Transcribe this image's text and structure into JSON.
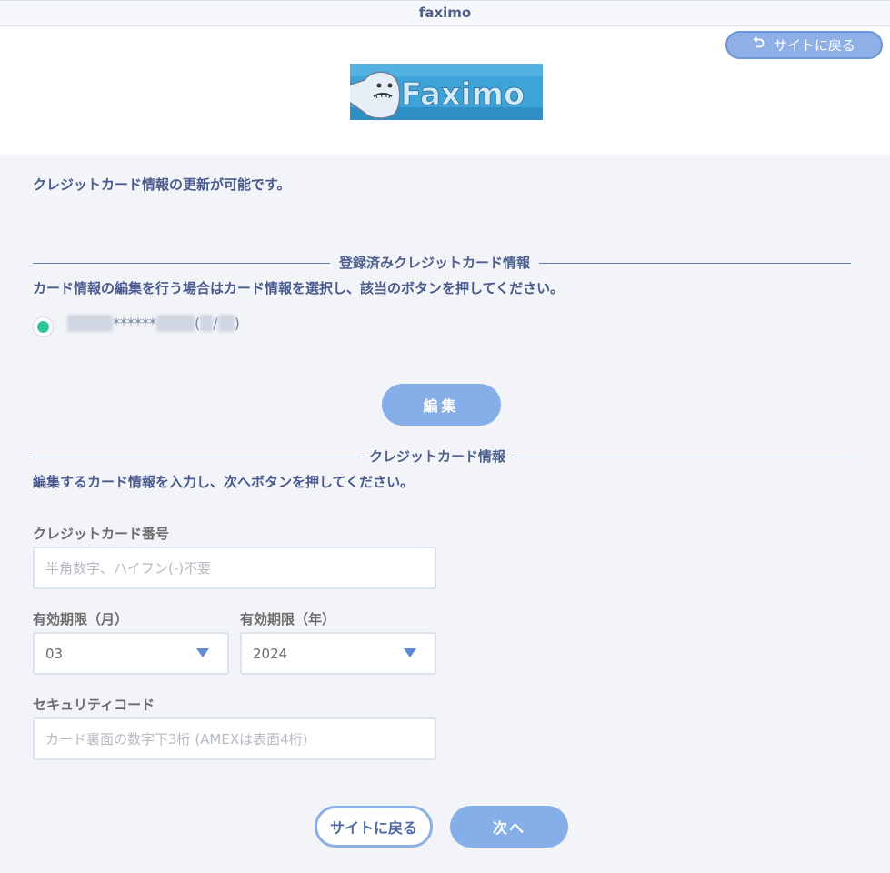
{
  "window": {
    "title": "faximo"
  },
  "header": {
    "back_link": {
      "label": "サイトに戻る",
      "icon": "return-arrow-icon"
    },
    "logo": {
      "text": "Faximo",
      "bg_color": "#3ea3d6"
    }
  },
  "notice": "クレジットカード情報の更新が可能です。",
  "registered": {
    "section_title": "登録済みクレジットカード情報",
    "description": "カード情報の編集を行う場合はカード情報を選択し、該当のボタンを押してください。",
    "card": {
      "mask": "******",
      "paren_open": "(",
      "slash": "/",
      "paren_close": ")",
      "selected": true
    },
    "edit_button": "編集"
  },
  "new_card": {
    "section_title": "クレジットカード情報",
    "description": "編集するカード情報を入力し、次へボタンを押してください。",
    "card_number": {
      "label": "クレジットカード番号",
      "placeholder": "半角数字、ハイフン(-)不要",
      "value": ""
    },
    "expiry_month": {
      "label": "有効期限（月）",
      "value": "03"
    },
    "expiry_year": {
      "label": "有効期限（年）",
      "value": "2024"
    },
    "security_code": {
      "label": "セキュリティコード",
      "placeholder": "カード裏面の数字下3桁 (AMEXは表面4桁)",
      "value": ""
    }
  },
  "footer": {
    "back_button": "サイトに戻る",
    "next_button": "次へ"
  },
  "colors": {
    "accent": "#86aee8",
    "radio_selected": "#2ec694",
    "section_line": "#5d7fb7",
    "text": "#4a5a8e"
  }
}
